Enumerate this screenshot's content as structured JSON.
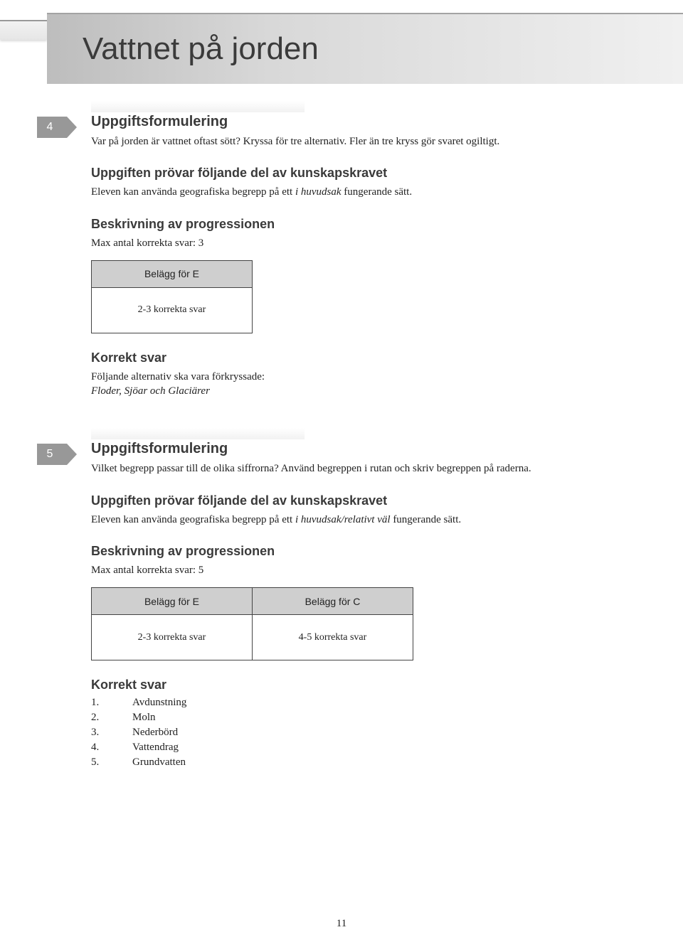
{
  "page_title": "Vattnet på jorden",
  "page_number": "11",
  "tasks": [
    {
      "badge": "4",
      "formulation_heading": "Uppgiftsformulering",
      "formulation_body": "Var på jorden är vattnet oftast sött? Kryssa för tre alternativ. Fler än tre kryss gör svaret ogiltigt.",
      "kravet_heading": "Uppgiften prövar följande del av kunskapskravet",
      "kravet_body_pre": "Eleven kan använda geografiska begrepp på ett ",
      "kravet_body_em": "i huvudsak",
      "kravet_body_post": " fungerande sätt.",
      "progress_heading": "Beskrivning av progressionen",
      "progress_sub": "Max antal korrekta svar: 3",
      "prog_cols": [
        {
          "header": "Belägg för E",
          "cell": "2-3 korrekta svar"
        }
      ],
      "correct_heading": "Korrekt svar",
      "correct_body": "Följande alternativ ska vara förkryssade:",
      "correct_em": "Floder, Sjöar och Glaciärer"
    },
    {
      "badge": "5",
      "formulation_heading": "Uppgiftsformulering",
      "formulation_body": "Vilket begrepp passar till de olika siffrorna? Använd begreppen i rutan och skriv begreppen på raderna.",
      "kravet_heading": "Uppgiften prövar följande del av kunskapskravet",
      "kravet_body_pre": "Eleven kan använda geografiska begrepp på ett ",
      "kravet_body_em": "i huvudsak/relativt väl",
      "kravet_body_post": " fungerande sätt.",
      "progress_heading": "Beskrivning av progressionen",
      "progress_sub": "Max antal korrekta svar: 5",
      "prog_cols": [
        {
          "header": "Belägg för E",
          "cell": "2-3 korrekta svar"
        },
        {
          "header": "Belägg för C",
          "cell": "4-5 korrekta svar"
        }
      ],
      "correct_heading": "Korrekt svar",
      "answers": [
        {
          "n": "1.",
          "v": "Avdunstning"
        },
        {
          "n": "2.",
          "v": "Moln"
        },
        {
          "n": "3.",
          "v": "Nederbörd"
        },
        {
          "n": "4.",
          "v": "Vattendrag"
        },
        {
          "n": "5.",
          "v": "Grundvatten"
        }
      ]
    }
  ]
}
